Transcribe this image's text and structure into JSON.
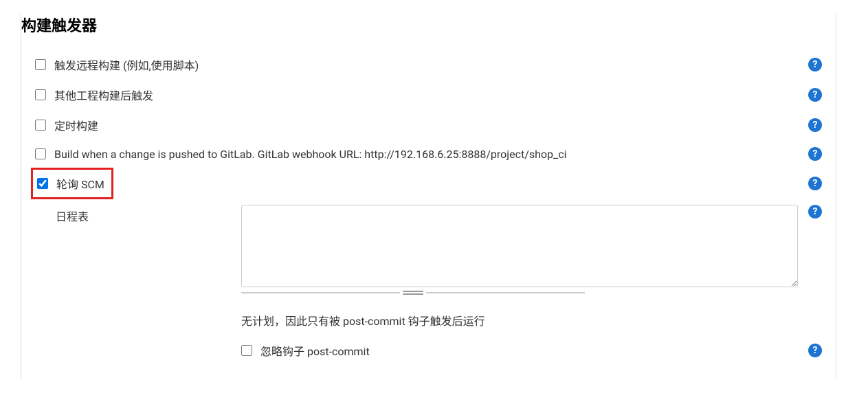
{
  "section": {
    "title": "构建触发器"
  },
  "triggers": {
    "remote": {
      "label": "触发远程构建 (例如,使用脚本)",
      "checked": false
    },
    "afterOther": {
      "label": "其他工程构建后触发",
      "checked": false
    },
    "scheduled": {
      "label": "定时构建",
      "checked": false
    },
    "gitlab": {
      "label": "Build when a change is pushed to GitLab. GitLab webhook URL: http://192.168.6.25:8888/project/shop_ci",
      "checked": false
    },
    "pollScm": {
      "label": "轮询 SCM",
      "checked": true
    }
  },
  "schedule": {
    "label": "日程表",
    "value": "",
    "infoText": "无计划，因此只有被 post-commit 钩子触发后运行"
  },
  "ignoreHooks": {
    "label": "忽略钩子 post-commit",
    "checked": false
  },
  "helpGlyph": "?"
}
